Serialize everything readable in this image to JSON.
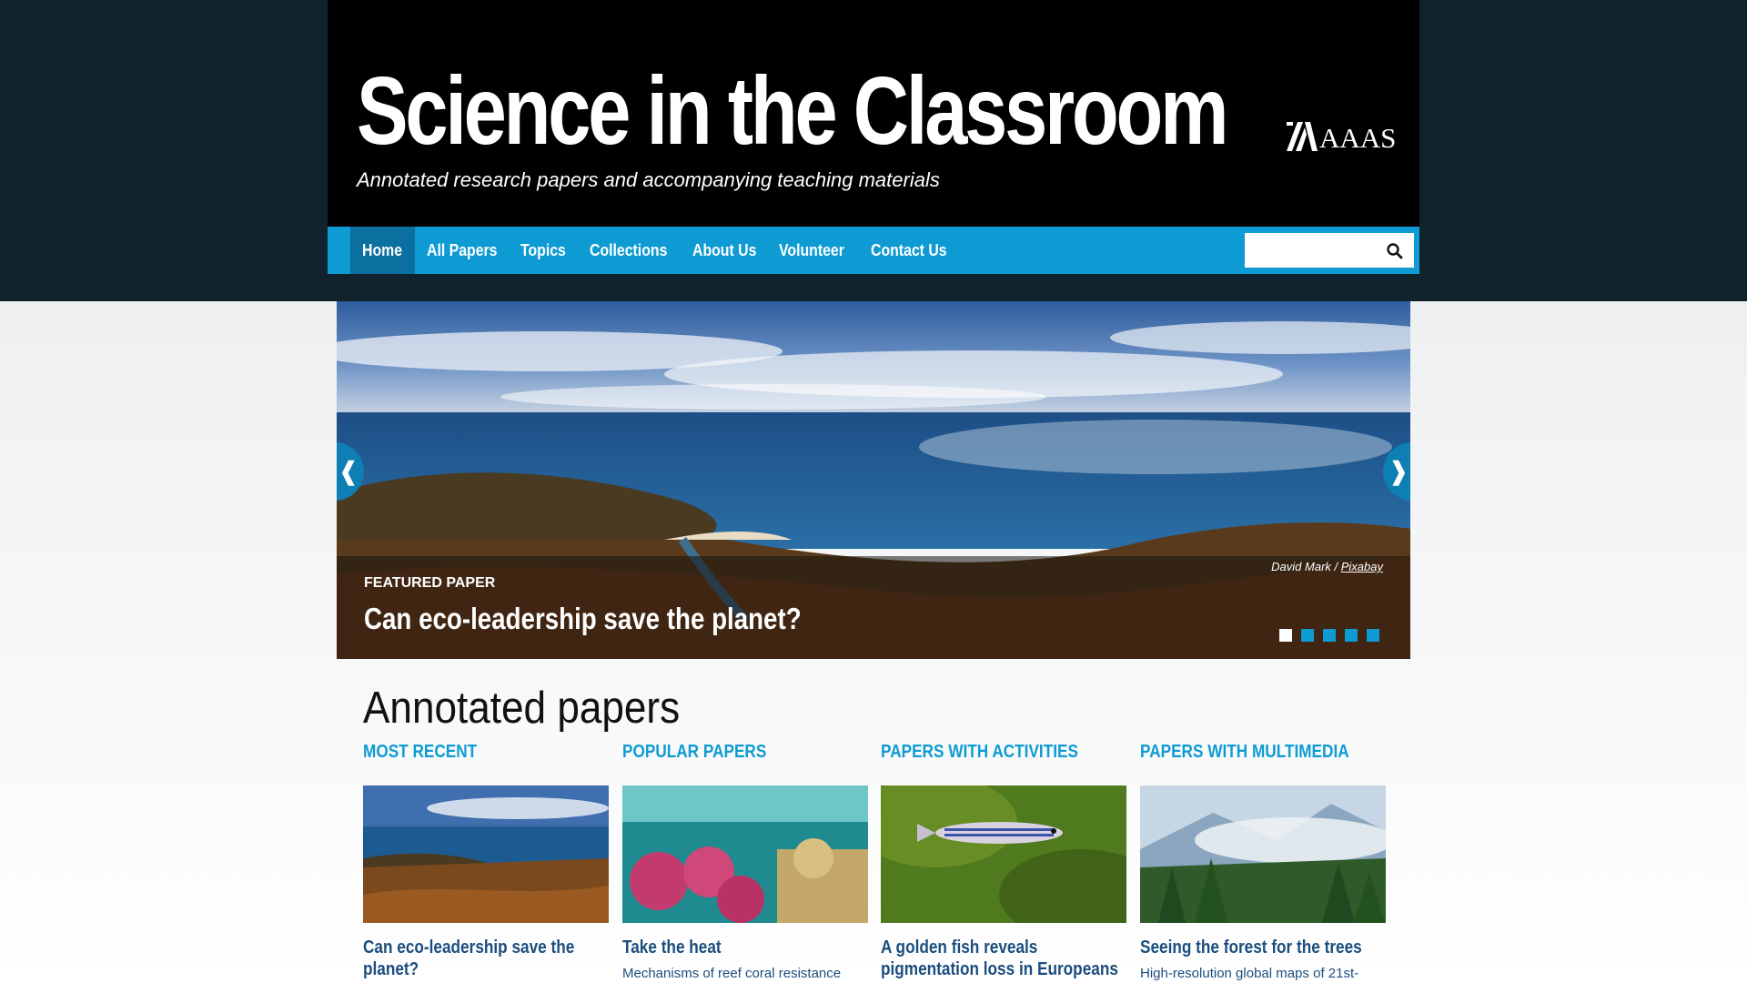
{
  "header": {
    "title": "Science in the Classroom",
    "tagline": "Annotated research papers and accompanying teaching materials",
    "logo_text": "AAAS"
  },
  "nav": {
    "items": [
      {
        "label": "Home",
        "active": true
      },
      {
        "label": "All Papers"
      },
      {
        "label": "Topics"
      },
      {
        "label": "Collections"
      },
      {
        "label": "About Us"
      },
      {
        "label": "Volunteer"
      },
      {
        "label": "Contact Us"
      }
    ],
    "search_placeholder": "",
    "search_icon": "search-icon"
  },
  "carousel": {
    "label": "FEATURED PAPER",
    "title": "Can eco-leadership save the planet?",
    "credit_author": "David Mark / ",
    "credit_source": "Pixabay",
    "prev_arrow": "❰",
    "next_arrow": "❱",
    "slide_count": 5,
    "active_slide": 1
  },
  "section": {
    "heading": "Annotated papers",
    "columns": [
      {
        "title": "MOST RECENT",
        "card_title": "Can eco-leadership save the planet?",
        "card_desc": ""
      },
      {
        "title": "POPULAR PAPERS",
        "card_title": "Take the heat",
        "card_desc": "Mechanisms of reef coral resistance"
      },
      {
        "title": "PAPERS WITH ACTIVITIES",
        "card_title": "A golden fish reveals pigmentation loss in Europeans",
        "card_desc": ""
      },
      {
        "title": "PAPERS WITH MULTIMEDIA",
        "card_title": "Seeing the forest for the trees",
        "card_desc": "High-resolution global maps of 21st-"
      }
    ]
  },
  "colors": {
    "page_band": "#10222c",
    "header_bg": "#000000",
    "nav_bg": "#0e9bd3",
    "nav_active": "#0b6fa0",
    "accent": "#0e9bd3",
    "link": "#1b4d7d"
  }
}
